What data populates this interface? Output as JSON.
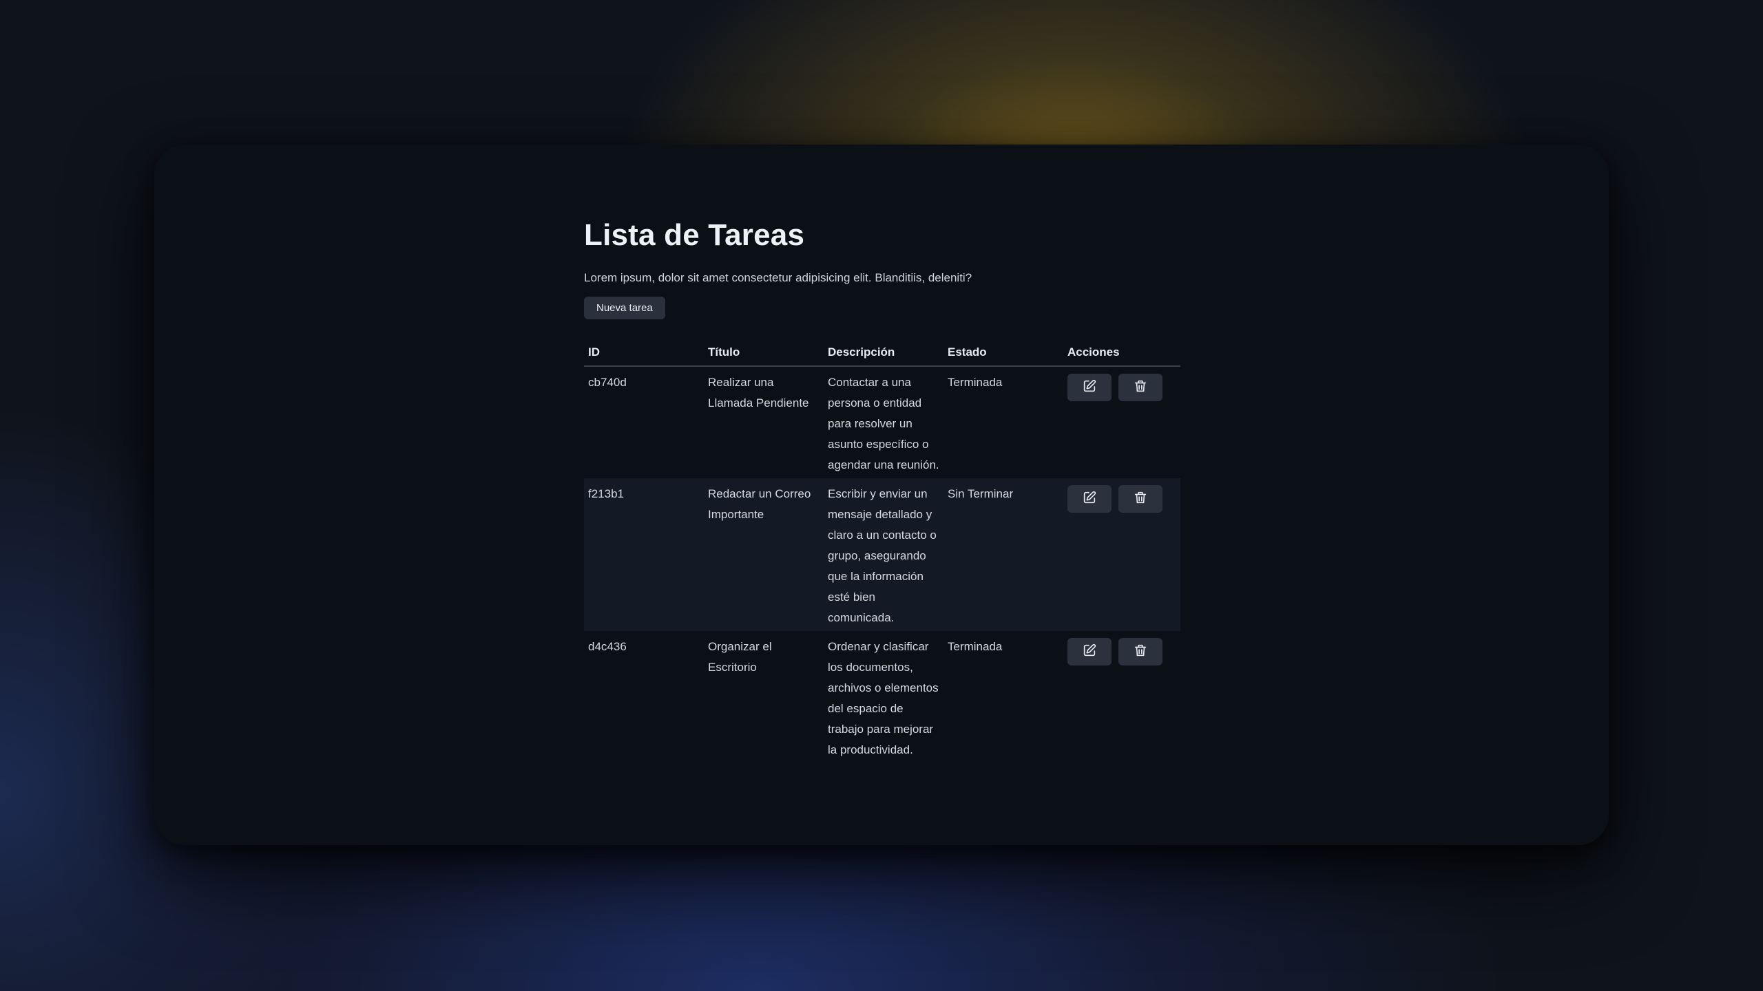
{
  "page": {
    "title": "Lista de Tareas",
    "description": "Lorem ipsum, dolor sit amet consectetur adipisicing elit. Blanditiis, deleniti?",
    "new_task_label": "Nueva tarea"
  },
  "table": {
    "headers": {
      "id": "ID",
      "title": "Título",
      "description": "Descripción",
      "status": "Estado",
      "actions": "Acciones"
    },
    "rows": [
      {
        "id": "cb740d",
        "title": "Realizar una Llamada Pendiente",
        "description": "Contactar a una persona o entidad para resolver un asunto específico o agendar una reunión.",
        "status": "Terminada"
      },
      {
        "id": "f213b1",
        "title": "Redactar un Correo Importante",
        "description": "Escribir y enviar un mensaje detallado y claro a un contacto o grupo, asegurando que la información esté bien comunicada.",
        "status": "Sin Terminar"
      },
      {
        "id": "d4c436",
        "title": "Organizar el Escritorio",
        "description": "Ordenar y clasificar los documentos, archivos o elementos del espacio de trabajo para mejorar la productividad.",
        "status": "Terminada"
      }
    ]
  },
  "icons": {
    "edit": "edit-icon",
    "delete": "trash-icon"
  },
  "colors": {
    "window_bg": "#0b0f16",
    "button_bg": "#2c323d",
    "striped_row_bg": "#131a25",
    "text": "#e6e8ec"
  }
}
